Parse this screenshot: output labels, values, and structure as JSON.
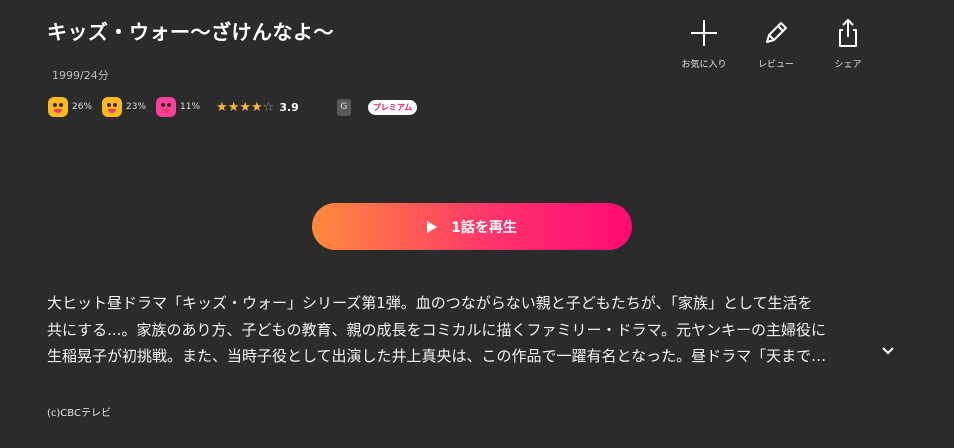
{
  "title": "キッズ・ウォー〜ざけんなよ〜",
  "meta": "1999/24分",
  "reactions": [
    {
      "icon": "surprised-face-icon",
      "percent": "26%"
    },
    {
      "icon": "laughing-face-icon",
      "percent": "23%"
    },
    {
      "icon": "heart-eyes-face-icon",
      "percent": "11%"
    }
  ],
  "rating": {
    "score": "3.9",
    "stars": 3.5,
    "max": 5
  },
  "grade": "G",
  "premium_badge": "プレミアム",
  "actions": {
    "favorite": "お気に入り",
    "review": "レビュー",
    "share": "シェア"
  },
  "play_button": "1話を再生",
  "description": {
    "line1": "大ヒット昼ドラマ「キッズ・ウォー」シリーズ第1弾。血のつながらない親と子どもたちが、「家族」として生活を",
    "line2": "共にする...。家族のあり方、子どもの教育、親の成長をコミカルに描くファミリー・ドラマ。元ヤンキーの主婦役に",
    "line3": "生稲晃子が初挑戦。また、当時子役として出演した井上真央は、この作品で一躍有名となった。昼ドラマ「天まで…"
  },
  "copyright": "(c)CBCテレビ",
  "colors": {
    "background": "#2b2b2b",
    "accent_start": "#ff8a3c",
    "accent_end": "#ff0a72",
    "star": "#f6b73c"
  }
}
